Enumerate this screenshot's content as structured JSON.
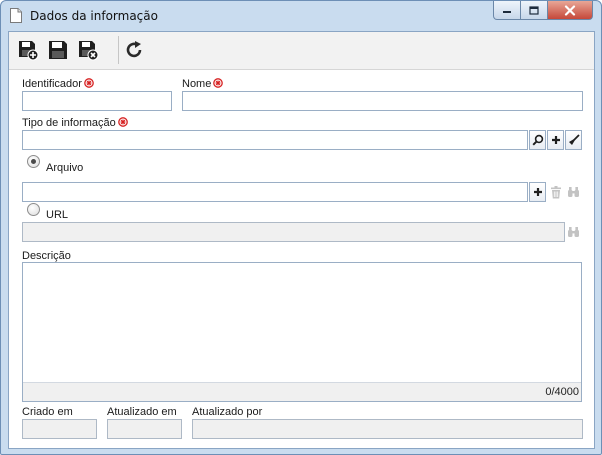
{
  "window": {
    "title": "Dados da informação",
    "controls": {
      "minimize_icon": "minimize-icon",
      "maximize_icon": "maximize-icon",
      "close_icon": "close-icon"
    }
  },
  "toolbar": {
    "buttons": [
      {
        "id": "save-new",
        "icon": "save-plus-icon"
      },
      {
        "id": "save",
        "icon": "save-icon"
      },
      {
        "id": "save-close",
        "icon": "save-close-icon"
      },
      {
        "id": "refresh",
        "icon": "refresh-icon"
      }
    ]
  },
  "form": {
    "identificador": {
      "label": "Identificador",
      "value": ""
    },
    "nome": {
      "label": "Nome",
      "value": ""
    },
    "tipo": {
      "label": "Tipo de informação",
      "value": ""
    },
    "arquivo": {
      "label": "Arquivo",
      "value": "",
      "selected": true
    },
    "url": {
      "label": "URL",
      "value": "",
      "selected": false
    },
    "descricao": {
      "label": "Descrição",
      "value": "",
      "counter": "0/4000"
    },
    "criado_em": {
      "label": "Criado em",
      "value": ""
    },
    "atualizado_em": {
      "label": "Atualizado em",
      "value": ""
    },
    "atualizado_por": {
      "label": "Atualizado por",
      "value": ""
    }
  },
  "colors": {
    "required": "#d62020",
    "frame": "#c9dcef",
    "field_border": "#9aaec5"
  }
}
